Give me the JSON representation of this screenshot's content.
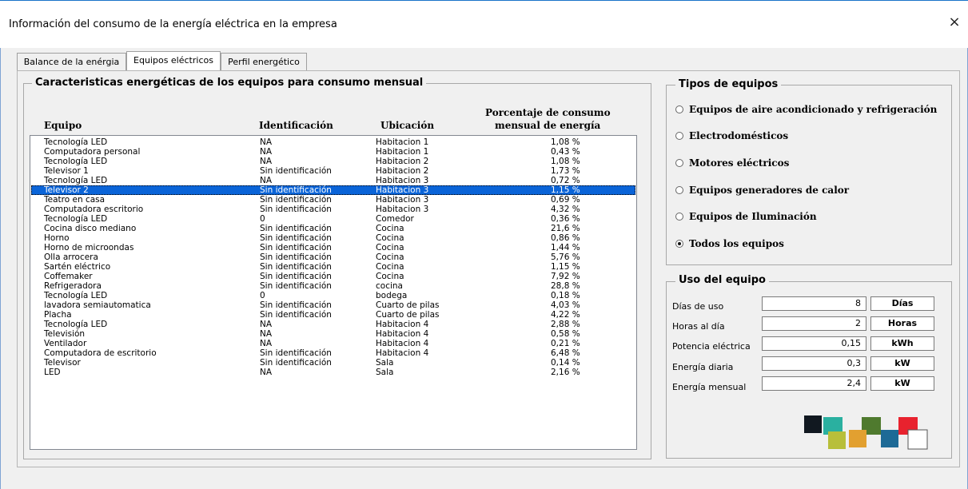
{
  "window": {
    "title": "Información del consumo de la energía eléctrica en la empresa",
    "close_label": "×"
  },
  "tabs": [
    {
      "label": "Balance de la enérgia",
      "active": false
    },
    {
      "label": "Equipos eléctricos",
      "active": true
    },
    {
      "label": "Perfil energético",
      "active": false
    }
  ],
  "equipment_panel": {
    "title": "Caracteristicas energéticas de los equipos para consumo mensual",
    "columns": {
      "equipo": "Equipo",
      "identificacion": "Identificación",
      "ubicacion": "Ubicación",
      "porcentaje_line1": "Porcentaje de consumo",
      "porcentaje_line2": "mensual de energía"
    },
    "rows": [
      {
        "equipo": "Tecnología LED",
        "identificacion": "NA",
        "ubicacion": "Habitacion 1",
        "porcentaje": "1,08 %"
      },
      {
        "equipo": "Computadora personal",
        "identificacion": "NA",
        "ubicacion": "Habitacion 1",
        "porcentaje": "0,43 %"
      },
      {
        "equipo": "Tecnología LED",
        "identificacion": "NA",
        "ubicacion": "Habitacion 2",
        "porcentaje": "1,08 %"
      },
      {
        "equipo": "Televisor 1",
        "identificacion": "Sin identificación",
        "ubicacion": "Habitacion 2",
        "porcentaje": "1,73 %"
      },
      {
        "equipo": "Tecnología LED",
        "identificacion": "NA",
        "ubicacion": "Habitacion 3",
        "porcentaje": "0,72 %"
      },
      {
        "equipo": "Televisor 2",
        "identificacion": "Sin identificación",
        "ubicacion": "Habitacion 3",
        "porcentaje": "1,15 %",
        "selected": true
      },
      {
        "equipo": "Teatro en casa",
        "identificacion": "Sin identificación",
        "ubicacion": "Habitacion 3",
        "porcentaje": "0,69 %"
      },
      {
        "equipo": "Computadora escritorio",
        "identificacion": "Sin identificación",
        "ubicacion": "Habitacion 3",
        "porcentaje": "4,32 %"
      },
      {
        "equipo": "Tecnología LED",
        "identificacion": "0",
        "ubicacion": "Comedor",
        "porcentaje": "0,36 %"
      },
      {
        "equipo": "Cocina disco mediano",
        "identificacion": "Sin identificación",
        "ubicacion": "Cocina",
        "porcentaje": "21,6 %"
      },
      {
        "equipo": "Horno",
        "identificacion": "Sin identificación",
        "ubicacion": "Cocina",
        "porcentaje": "0,86 %"
      },
      {
        "equipo": "Horno de microondas",
        "identificacion": "Sin identificación",
        "ubicacion": "Cocina",
        "porcentaje": "1,44 %"
      },
      {
        "equipo": "Olla arrocera",
        "identificacion": "Sin identificación",
        "ubicacion": "Cocina",
        "porcentaje": "5,76 %"
      },
      {
        "equipo": "Sartén eléctrico",
        "identificacion": "Sin identificación",
        "ubicacion": "Cocina",
        "porcentaje": "1,15 %"
      },
      {
        "equipo": "Coffemaker",
        "identificacion": "Sin identificación",
        "ubicacion": "Cocina",
        "porcentaje": "7,92 %"
      },
      {
        "equipo": "Refrigeradora",
        "identificacion": "Sin identificación",
        "ubicacion": "cocina",
        "porcentaje": "28,8 %"
      },
      {
        "equipo": "Tecnología LED",
        "identificacion": "0",
        "ubicacion": "bodega",
        "porcentaje": "0,18 %"
      },
      {
        "equipo": "lavadora semiautomatica",
        "identificacion": "Sin identificación",
        "ubicacion": "Cuarto de pilas",
        "porcentaje": "4,03 %"
      },
      {
        "equipo": "Placha",
        "identificacion": "Sin identificación",
        "ubicacion": "Cuarto de pilas",
        "porcentaje": "4,22 %"
      },
      {
        "equipo": "Tecnología LED",
        "identificacion": "NA",
        "ubicacion": "Habitacion 4",
        "porcentaje": "2,88 %"
      },
      {
        "equipo": "Televisión",
        "identificacion": "NA",
        "ubicacion": "Habitacion 4",
        "porcentaje": "0,58 %"
      },
      {
        "equipo": "Ventilador",
        "identificacion": "NA",
        "ubicacion": "Habitacion 4",
        "porcentaje": "0,21 %"
      },
      {
        "equipo": "Computadora de escritorio",
        "identificacion": "Sin identificación",
        "ubicacion": "Habitacion 4",
        "porcentaje": "6,48 %"
      },
      {
        "equipo": "Televisor",
        "identificacion": "Sin identificación",
        "ubicacion": "Sala",
        "porcentaje": "0,14 %"
      },
      {
        "equipo": "LED",
        "identificacion": "NA",
        "ubicacion": "Sala",
        "porcentaje": "2,16 %"
      }
    ]
  },
  "types_panel": {
    "title": "Tipos de equipos",
    "options": [
      {
        "label": "Equipos de aire acondicionado y refrigeración",
        "checked": false
      },
      {
        "label": "Electrodomésticos",
        "checked": false
      },
      {
        "label": "Motores eléctricos",
        "checked": false
      },
      {
        "label": "Equipos generadores de calor",
        "checked": false
      },
      {
        "label": "Equipos de Iluminación",
        "checked": false
      },
      {
        "label": "Todos los equipos",
        "checked": true
      }
    ]
  },
  "usage_panel": {
    "title": "Uso del equipo",
    "fields": [
      {
        "label": "Días de uso",
        "value": "8",
        "unit": "Días"
      },
      {
        "label": "Horas al día",
        "value": "2",
        "unit": "Horas"
      },
      {
        "label": "Potencia eléctrica",
        "value": "0,15",
        "unit": "kWh"
      },
      {
        "label": "Energía diaria",
        "value": "0,3",
        "unit": "kW"
      },
      {
        "label": "Energía mensual",
        "value": "2,4",
        "unit": "kW"
      }
    ]
  },
  "logo": {
    "colors": [
      "#111820",
      "#2ab0a0",
      "#4f7a2e",
      "#e8222e",
      "#b8bf3a",
      "#e2a030",
      "#1e6a96",
      "#ffffff"
    ]
  }
}
